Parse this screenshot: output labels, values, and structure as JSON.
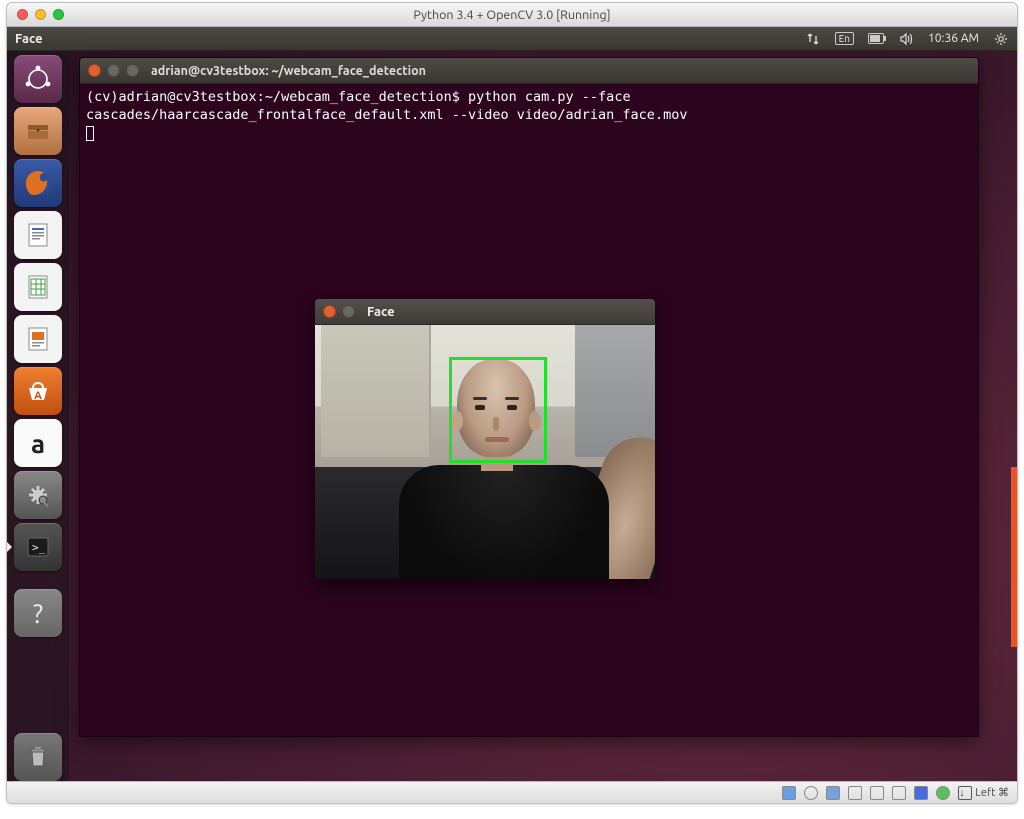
{
  "mac": {
    "title": "Python 3.4 + OpenCV 3.0 [Running]"
  },
  "topbar": {
    "app_name": "Face",
    "lang": "En",
    "time": "10:36 AM"
  },
  "launcher": {
    "items": [
      {
        "name": "dash",
        "glyph": "◌"
      },
      {
        "name": "files",
        "glyph": "🗄"
      },
      {
        "name": "firefox",
        "glyph": "🦊"
      },
      {
        "name": "writer",
        "glyph": "📄"
      },
      {
        "name": "calc",
        "glyph": "📊"
      },
      {
        "name": "impress",
        "glyph": "📙"
      },
      {
        "name": "software",
        "glyph": "A"
      },
      {
        "name": "amazon",
        "glyph": "a"
      },
      {
        "name": "settings",
        "glyph": "⚙"
      },
      {
        "name": "terminal",
        "glyph": ">_"
      },
      {
        "name": "help",
        "glyph": "?"
      },
      {
        "name": "trash",
        "glyph": "🗑"
      }
    ]
  },
  "terminal": {
    "title": "adrian@cv3testbox: ~/webcam_face_detection",
    "prompt": "(cv)adrian@cv3testbox:~/webcam_face_detection$",
    "command": "python cam.py --face cascades/haarcascade_frontalface_default.xml --video video/adrian_face.mov"
  },
  "face_window": {
    "title": "Face"
  },
  "vbox": {
    "host_key": "Left ⌘"
  }
}
